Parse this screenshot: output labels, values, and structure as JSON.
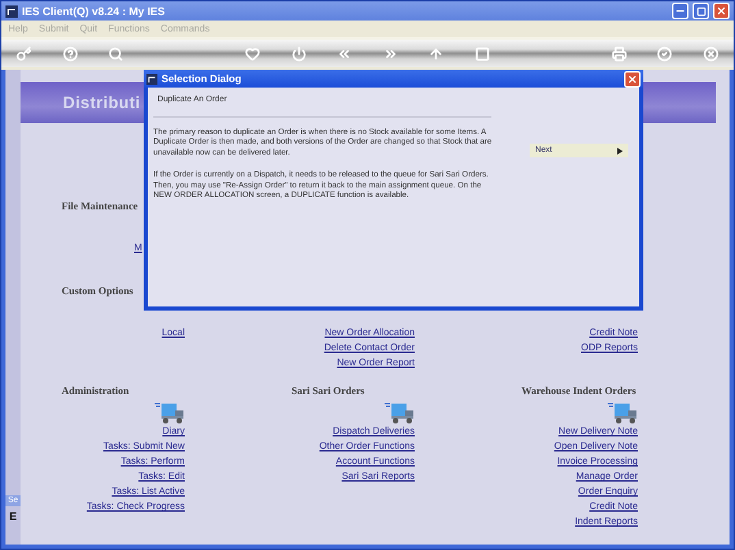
{
  "window": {
    "title": "IES Client(Q) v8.24 : My IES"
  },
  "menu": [
    "Help",
    "Submit",
    "Quit",
    "Functions",
    "Commands"
  ],
  "page": {
    "title": "Distributi"
  },
  "top_groups": [
    {
      "heading": "File Maintenance",
      "kind": "partial",
      "columns": [
        [
          "M"
        ]
      ]
    },
    {
      "heading": "Custom Options",
      "kind": "columns",
      "columns": [
        [
          "Local"
        ],
        [
          "New Order Allocation",
          "Delete Contact Order",
          "New Order Report"
        ],
        [
          "Credit Note",
          "ODP Reports"
        ]
      ]
    }
  ],
  "columns": [
    {
      "heading": "Administration",
      "links": [
        "Diary",
        "Tasks: Submit New",
        "Tasks: Perform",
        "Tasks: Edit",
        "Tasks: List Active",
        "Tasks: Check Progress"
      ]
    },
    {
      "heading": "Sari Sari Orders",
      "links": [
        "Dispatch Deliveries",
        "Other Order Functions",
        "Account Functions",
        "Sari Sari Reports"
      ]
    },
    {
      "heading": "Warehouse Indent Orders",
      "links": [
        "New Delivery Note",
        "Open Delivery Note",
        "Invoice Processing",
        "Manage Order",
        "Order Enquiry",
        "Credit Note",
        "Indent Reports"
      ]
    }
  ],
  "side_tab": {
    "label": "Se",
    "glyph": "E"
  },
  "dialog": {
    "title": "Selection Dialog",
    "subtitle": "Duplicate An Order",
    "paragraphs": [
      "The primary reason to duplicate an Order is when there is no Stock available for some Items. A Duplicate Order is then made, and both versions of the Order are changed so that Stock that are unavailable now can be delivered later.",
      "If the Order is currently on a Dispatch, it needs to be released to the queue for Sari Sari Orders. Then, you may use \"Re-Assign Order\" to return it back to the main assignment queue. On the NEW ORDER ALLOCATION screen, a DUPLICATE function is available."
    ],
    "options": [
      {
        "label": "Next",
        "selected": true
      }
    ]
  }
}
